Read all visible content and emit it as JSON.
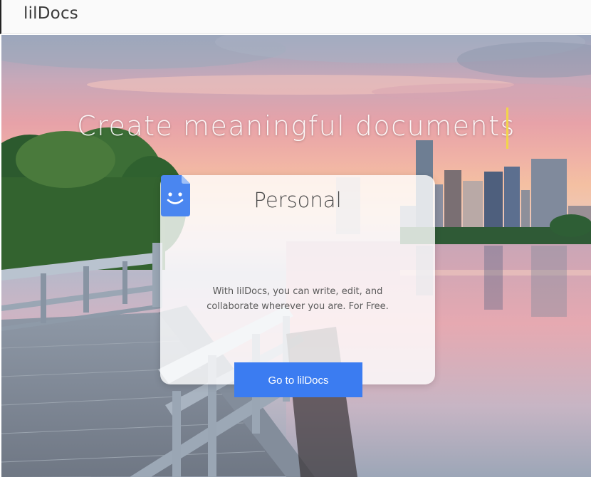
{
  "app": {
    "brand": "lilDocs"
  },
  "hero": {
    "headline": "Create meaningful documents"
  },
  "card": {
    "title": "Personal",
    "icon": "smiling-document-icon",
    "description": "With lilDocs, you can write, edit, and collaborate wherever you are. For Free.",
    "button_label": "Go to lilDocs"
  },
  "colors": {
    "accent": "#3b7cf1",
    "cursor": "#f2d54a",
    "topbar": "#fafafa"
  }
}
